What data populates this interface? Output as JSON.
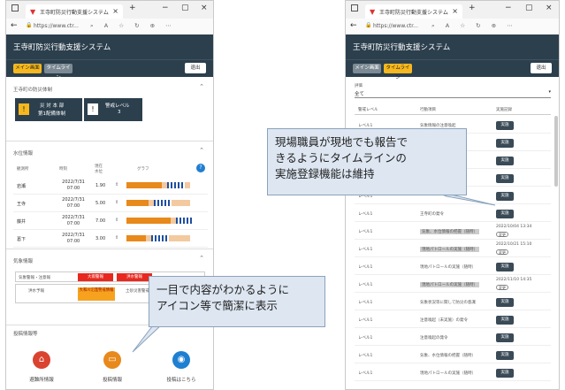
{
  "browser": {
    "tab_title": "王寺町防災行動支援システム",
    "url": "https://www.ctr..."
  },
  "app": {
    "title": "王寺町防災行動支援システム",
    "tabs": [
      "メイン画面",
      "タイムライン"
    ],
    "logout": "退出"
  },
  "left": {
    "section_status": "王寺町の防災体制",
    "status_cards": [
      {
        "icon": "!",
        "line1": "災 対 本 部",
        "line2": "第1配備体制"
      },
      {
        "icon": "!",
        "line1": "警戒レベル",
        "line2": "3"
      }
    ],
    "section_water": "水位情報",
    "water_headers": [
      "観測所",
      "時刻",
      "現在水位",
      "",
      "グラフ"
    ],
    "water_rows": [
      {
        "name": "岩瀬",
        "time": "2022/7/31 07:00",
        "level": "1.90",
        "trend": "⇧",
        "bar": 0.55
      },
      {
        "name": "王寺",
        "time": "2022/7/31 07:00",
        "level": "5.00",
        "trend": "⇧",
        "bar": 0.35
      },
      {
        "name": "藤井",
        "time": "2022/7/31 07:00",
        "level": "7.00",
        "trend": "⇧",
        "bar": 0.7
      },
      {
        "name": "葛下",
        "time": "2022/7/31 07:00",
        "level": "3.00",
        "trend": "⇧",
        "bar": 0.3
      }
    ],
    "section_weather": "気象情報",
    "weather_rows": [
      {
        "label": "気象警報・注意報",
        "chips": [
          "大雨警報",
          "洪水警報"
        ]
      },
      {
        "label": "洪水予報",
        "chips": [
          "大和川氾濫警戒情報"
        ],
        "extra": "土砂災害警戒"
      }
    ],
    "section_post": "投稿情報等",
    "bottom_nav": [
      {
        "label": "避難所情報",
        "icon": "house-icon",
        "color": "#d9432f"
      },
      {
        "label": "投稿情報",
        "icon": "post-icon",
        "color": "#e8891b"
      },
      {
        "label": "投稿はこちら",
        "icon": "camera-icon",
        "color": "#1f7fd0"
      }
    ]
  },
  "right": {
    "filter_label": "評価",
    "filter_value": "全て",
    "headers": [
      "警戒レベル",
      "行動項目",
      "実施記録"
    ],
    "rows": [
      {
        "level": "レベル1",
        "action": "気象情報の注意喚起",
        "badge": "実施",
        "extra": ""
      },
      {
        "level": "レベル1",
        "action": "情報提供の開始",
        "badge": "実施",
        "extra": ""
      },
      {
        "level": "レベル1",
        "action": "",
        "badge": "実施",
        "extra": ""
      },
      {
        "level": "レベル1",
        "action": "必要に応じ",
        "badge": "実施",
        "extra": ""
      },
      {
        "level": "レベル1",
        "action": "",
        "badge": "実施",
        "extra": ""
      },
      {
        "level": "レベル1",
        "action": "王寺町の発令",
        "badge": "実施",
        "extra": ""
      },
      {
        "level": "レベル1",
        "action": "気象、水位情報の把握（随時）",
        "badge": "",
        "extra": "2022/10/04 13:34",
        "edit": "変更"
      },
      {
        "level": "レベル1",
        "action": "現地パトロールの実施（随時）",
        "badge": "",
        "extra": "2022/10/21 15:10",
        "edit": "変更"
      },
      {
        "level": "レベル1",
        "action": "現地パトロールの実施（随時）",
        "badge": "実施",
        "extra": ""
      },
      {
        "level": "レベル1",
        "action": "現地パトロールの実施（随時）",
        "badge": "",
        "extra": "2022/11/10 14:35",
        "edit": "変更"
      },
      {
        "level": "レベル1",
        "action": "気象状況等に関して防災の意識",
        "badge": "実施",
        "extra": ""
      },
      {
        "level": "レベル1",
        "action": "注意喚起（未実施）の発令",
        "badge": "実施",
        "extra": ""
      },
      {
        "level": "レベル1",
        "action": "注意喚起の発令",
        "badge": "実施",
        "extra": ""
      },
      {
        "level": "レベル1",
        "action": "気象、水位情報の把握（随時）",
        "badge": "実施",
        "extra": ""
      },
      {
        "level": "レベル1",
        "action": "現地パトロールの実施（随時）",
        "badge": "実施",
        "extra": ""
      }
    ]
  },
  "callouts": {
    "right": "現場職員が現地でも報告で\nきるようにタイムラインの\n実施登録機能は維持",
    "left": "一目で内容がわかるように\nアイコン等で簡潔に表示"
  }
}
